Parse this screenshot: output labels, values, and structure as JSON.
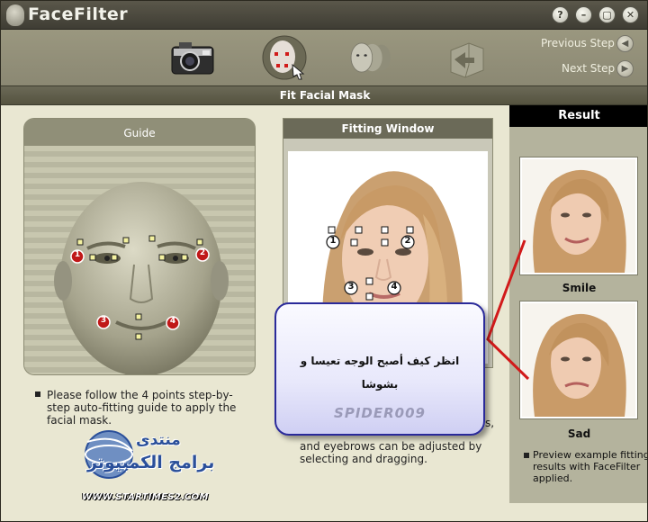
{
  "app": {
    "title": "FaceFilter"
  },
  "window_buttons": [
    {
      "name": "help",
      "glyph": "?"
    },
    {
      "name": "minimize",
      "glyph": "–"
    },
    {
      "name": "restore",
      "glyph": "▢"
    },
    {
      "name": "close",
      "glyph": "✕"
    }
  ],
  "toolbar": {
    "previous_step": "Previous Step",
    "next_step": "Next Step",
    "steps": [
      "camera-icon",
      "face-mask-icon",
      "faces-icon",
      "export-icon"
    ],
    "active_step": 1
  },
  "step_title": "Fit Facial Mask",
  "guide": {
    "title": "Guide",
    "points": [
      "1",
      "2",
      "3",
      "4"
    ],
    "note": "Please follow the 4 points step-by-step auto-fitting guide to apply the facial mask."
  },
  "fitting_window": {
    "title": "Fitting Window",
    "points": [
      "1",
      "2",
      "3",
      "4"
    ],
    "note_visible_fragment": "s,",
    "note": "and eyebrows can be adjusted by selecting and dragging."
  },
  "result": {
    "title": "Result",
    "items": [
      {
        "label": "Smile"
      },
      {
        "label": "Sad"
      }
    ],
    "note": "Preview example fitting results with FaceFilter applied."
  },
  "overlay": {
    "line1": "انظر كيف أصبح الوجه تعيسا و",
    "line2": "بشوشا",
    "watermark": "SPIDER009"
  },
  "forum": {
    "line1": "منتدى",
    "line2": "برامج الكمبيوتر",
    "url": "WWW.STARTIMES2.COM"
  },
  "colors": {
    "accent_red": "#d11a1a",
    "overlay_border": "#2a2a9a"
  }
}
